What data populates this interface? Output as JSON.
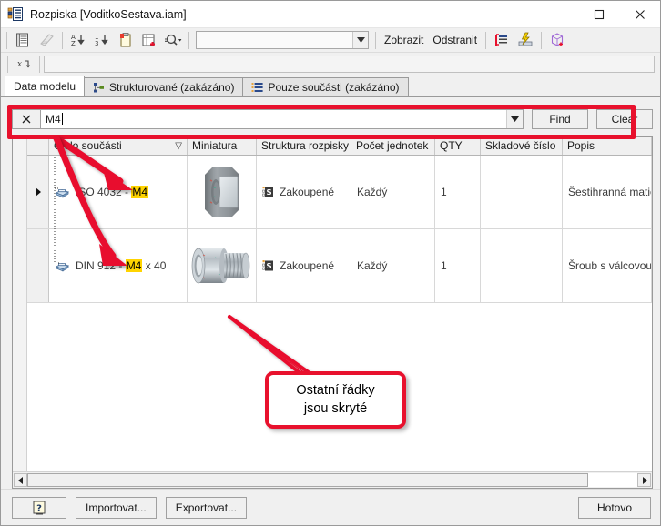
{
  "window": {
    "title": "Rozpiska [VoditkoSestava.iam]",
    "icon": "bom-table-icon",
    "controls": {
      "minimize": "minimize-icon",
      "maximize": "maximize-icon",
      "close": "close-icon"
    }
  },
  "toolbar": {
    "buttons": [
      {
        "name": "bom-settings-icon",
        "label": ""
      },
      {
        "name": "document-settings-icon",
        "label": ""
      },
      {
        "name": "sort-az-icon",
        "label": ""
      },
      {
        "name": "sort-numeric-icon",
        "label": ""
      },
      {
        "name": "add-custom-part-icon",
        "label": ""
      },
      {
        "name": "add-table-row-icon",
        "label": ""
      },
      {
        "name": "find-dropdown-icon",
        "label": ""
      }
    ],
    "combo_value": "",
    "show_label": "Zobrazit",
    "delete_label": "Odstranit",
    "right_buttons": [
      {
        "name": "renumber-items-icon"
      },
      {
        "name": "quantity-override-icon"
      },
      {
        "name": "part-properties-icon"
      }
    ]
  },
  "toolbar2": {
    "icon": "expression-filter-icon",
    "field_value": ""
  },
  "tabs": [
    {
      "label": "Data modelu",
      "icon": "",
      "active": true
    },
    {
      "label": "Strukturované (zakázáno)",
      "icon": "structured-view-icon",
      "active": false
    },
    {
      "label": "Pouze součásti (zakázáno)",
      "icon": "parts-only-icon",
      "active": false
    }
  ],
  "search": {
    "clear_icon": "close-x-icon",
    "value": "M4",
    "placeholder": "",
    "dropdown_icon": "chevron-down-icon",
    "find_label": "Find",
    "clear_label": "Clear"
  },
  "grid": {
    "columns": [
      {
        "label": "Číslo součásti",
        "width": 152,
        "sort": "▽"
      },
      {
        "label": "Miniatura",
        "width": 76,
        "sort": ""
      },
      {
        "label": "Struktura rozpisky",
        "width": 104,
        "sort": ""
      },
      {
        "label": "Počet jednotek",
        "width": 92,
        "sort": ""
      },
      {
        "label": "QTY",
        "width": 50,
        "sort": ""
      },
      {
        "label": "Skladové číslo",
        "width": 90,
        "sort": ""
      },
      {
        "label": "Popis",
        "width": 130,
        "sort": ""
      }
    ],
    "rows": [
      {
        "current": true,
        "part_icon": "component-icon",
        "part_prefix": "ISO 4032 - ",
        "part_highlight": "M4",
        "part_suffix": "",
        "thumbnail": "hex-nut-thumbnail",
        "structure_icon": "purchased-icon",
        "structure": "Zakoupené",
        "units": "Každý",
        "qty": "1",
        "stock_number": "",
        "description": "Šestihranná matice"
      },
      {
        "current": false,
        "part_icon": "component-icon",
        "part_prefix": "DIN 912 - ",
        "part_highlight": "M4",
        "part_suffix": " x 40",
        "thumbnail": "socket-head-screw-thumbnail",
        "structure_icon": "purchased-icon",
        "structure": "Zakoupené",
        "units": "Každý",
        "qty": "1",
        "stock_number": "",
        "description": "Šroub s válcovou hlavou"
      }
    ]
  },
  "footer": {
    "help_label": "?",
    "import_label": "Importovat...",
    "export_label": "Exportovat...",
    "done_label": "Hotovo"
  },
  "annotations": {
    "callout_line1": "Ostatní řádky",
    "callout_line2": "jsou skryté",
    "accent_color": "#e8112d",
    "highlight_color": "#ffd400"
  }
}
